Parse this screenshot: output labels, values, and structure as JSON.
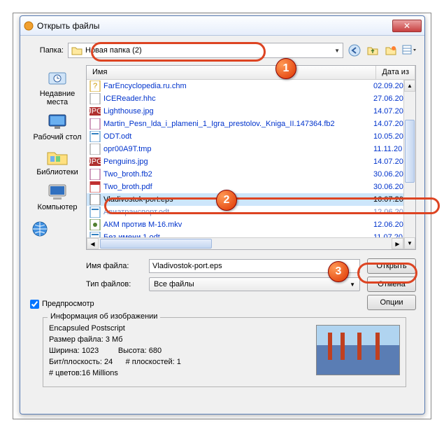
{
  "title": "Открыть файлы",
  "folder_label": "Папка:",
  "current_folder": "Новая папка (2)",
  "callouts": {
    "one": "1",
    "two": "2",
    "three": "3"
  },
  "places": {
    "recent": "Недавние места",
    "desktop": "Рабочий стол",
    "libraries": "Библиотеки",
    "computer": "Компьютер"
  },
  "columns": {
    "name": "Имя",
    "date": "Дата из"
  },
  "files": [
    {
      "icon": "chm",
      "name": "FarEncyclopedia.ru.chm",
      "date": "02.09.20"
    },
    {
      "icon": "hhc",
      "name": "ICEReader.hhc",
      "date": "27.06.20"
    },
    {
      "icon": "jpg",
      "name": "Lighthouse.jpg",
      "date": "14.07.20"
    },
    {
      "icon": "fb2",
      "name": "Martin_Pesn_lda_i_plameni_1_Igra_prestolov._Kniga_II.147364.fb2",
      "date": "14.07.20"
    },
    {
      "icon": "odt",
      "name": "ODT.odt",
      "date": "10.05.20"
    },
    {
      "icon": "tmp",
      "name": "opr00A9T.tmp",
      "date": "11.11.20"
    },
    {
      "icon": "jpg",
      "name": "Penguins.jpg",
      "date": "14.07.20"
    },
    {
      "icon": "fb2",
      "name": "Two_broth.fb2",
      "date": "30.06.20"
    },
    {
      "icon": "pdf",
      "name": "Two_broth.pdf",
      "date": "30.06.20"
    },
    {
      "icon": "eps",
      "name": "Vladivostok-port.eps",
      "date": "16.07.20",
      "selected": true
    },
    {
      "icon": "odt",
      "name": "Авиатранспорт.odt",
      "date": "12.06.20",
      "faded": true
    },
    {
      "icon": "mkv",
      "name": "АКМ против М-16.mkv",
      "date": "12.06.20"
    },
    {
      "icon": "odt",
      "name": "Без имени 1.odt",
      "date": "11.07.20"
    }
  ],
  "filename_label": "Имя файла:",
  "filename_value": "Vladivostok-port.eps",
  "filetype_label": "Тип файлов:",
  "filetype_value": "Все файлы",
  "btn_open": "Открыть",
  "btn_cancel": "Отмена",
  "btn_options": "Опции",
  "preview_label": "Предпросмотр",
  "info": {
    "title": "Информация об изображении",
    "format": "Encapsuled Postscript",
    "size_label": "Размер файла:",
    "size_value": "3 Мб",
    "width_label": "Ширина:",
    "width_value": "1023",
    "height_label": "Высота:",
    "height_value": "680",
    "bpp_label": "Бит/плоскость:",
    "bpp_value": "24",
    "planes_label": "# плоскостей:",
    "planes_value": "1",
    "colors_label": "# цветов:",
    "colors_value": "16 Millions"
  }
}
